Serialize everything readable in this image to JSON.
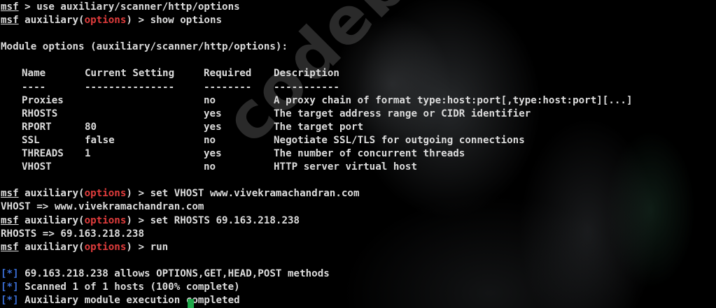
{
  "prompt": {
    "msf": "msf",
    "module_prefix": "auxiliary(",
    "module_name": "options",
    "module_suffix": ")",
    "arrow": " > "
  },
  "line1_cmd": "use auxiliary/scanner/http/options",
  "line2_cmd": "show options",
  "module_options_heading": "Module options (auxiliary/scanner/http/options):",
  "table": {
    "headers": [
      "Name",
      "Current Setting",
      "Required",
      "Description"
    ],
    "underline": [
      "----",
      "---------------",
      "--------",
      "-----------"
    ],
    "rows": [
      [
        "Proxies",
        "",
        "no",
        "A proxy chain of format type:host:port[,type:host:port][...]"
      ],
      [
        "RHOSTS",
        "",
        "yes",
        "The target address range or CIDR identifier"
      ],
      [
        "RPORT",
        "80",
        "yes",
        "The target port"
      ],
      [
        "SSL",
        "false",
        "no",
        "Negotiate SSL/TLS for outgoing connections"
      ],
      [
        "THREADS",
        "1",
        "yes",
        "The number of concurrent threads"
      ],
      [
        "VHOST",
        "",
        "no",
        "HTTP server virtual host"
      ]
    ]
  },
  "cmd_set_vhost": "set VHOST www.vivekramachandran.com",
  "out_vhost": "VHOST => www.vivekramachandran.com",
  "cmd_set_rhosts": "set RHOSTS 69.163.218.238",
  "out_rhosts": "RHOSTS => 69.163.218.238",
  "cmd_run": "run",
  "status_marker": "[*]",
  "results": [
    "69.163.218.238 allows OPTIONS,GET,HEAD,POST methods",
    "Scanned 1 of 1 hosts (100% complete)",
    "Auxiliary module execution completed"
  ],
  "watermark": "codebyte.net",
  "colors": {
    "background": "#000000",
    "text": "#dcdcdc",
    "module_name": "#e03c3c",
    "status_marker": "#3b6fd6",
    "cursor": "#1fa84a"
  }
}
